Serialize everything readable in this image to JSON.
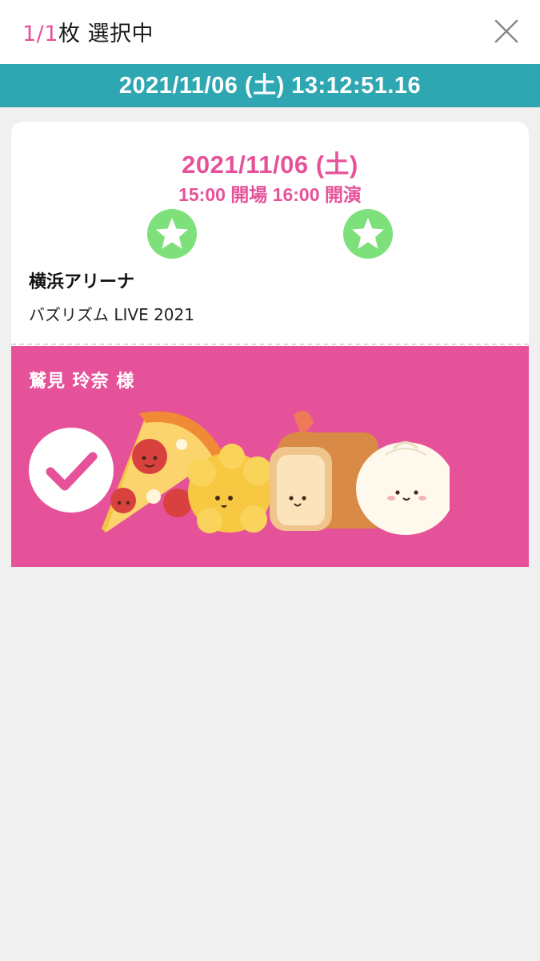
{
  "header": {
    "count": "1/1",
    "count_unit": "枚",
    "status": "選択中"
  },
  "timestamp": "2021/11/06 (土) 13:12:51.16",
  "ticket": {
    "date": "2021/11/06 (土)",
    "times": "15:00 開場 16:00 開演",
    "venue": "横浜アリーナ",
    "event": "バズリズム LIVE 2021",
    "holder": "鷲見 玲奈 様"
  },
  "colors": {
    "accent_pink": "#e6529a",
    "teal": "#2ea7b3",
    "star_green": "#7ee07a"
  },
  "icons": [
    "close-icon",
    "star-icon",
    "check-icon"
  ]
}
